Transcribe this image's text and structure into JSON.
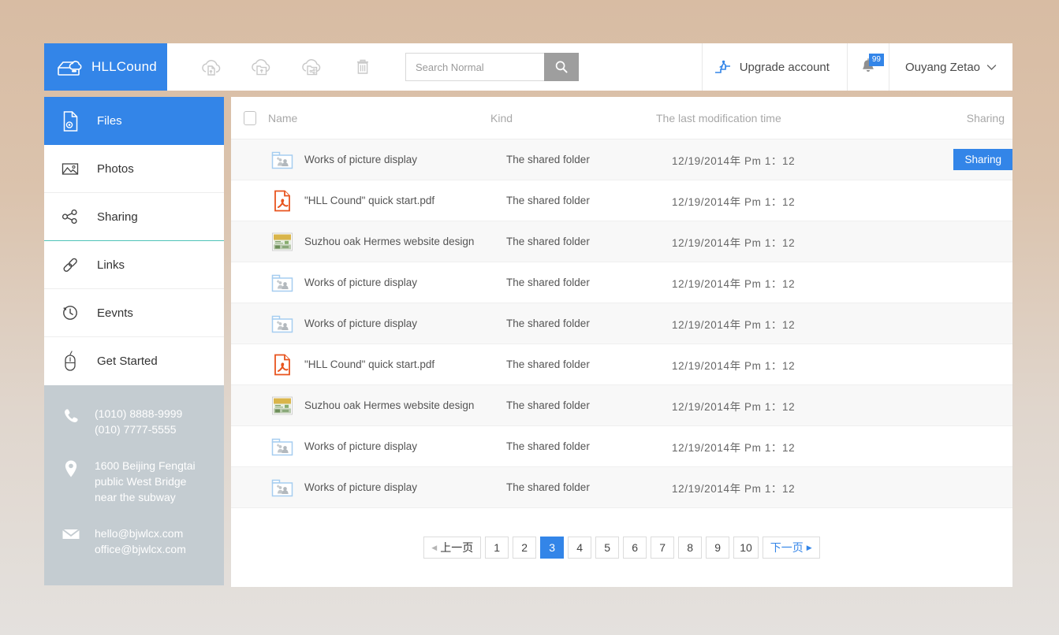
{
  "brand": {
    "name": "HLLCound",
    "logo_icon": "cloud-drive-logo-icon"
  },
  "toolbar": {
    "buttons": [
      {
        "name": "upload-file-icon",
        "label": "Upload file"
      },
      {
        "name": "upload-folder-icon",
        "label": "Upload folder"
      },
      {
        "name": "share-folder-icon",
        "label": "Share folder"
      },
      {
        "name": "trash-icon",
        "label": "Trash"
      }
    ]
  },
  "search": {
    "placeholder": "Search Normal",
    "value": "",
    "icon": "search-icon"
  },
  "account": {
    "upgrade_label": "Upgrade account",
    "upgrade_icon": "person-climbing-steps-icon",
    "notification_icon": "bell-icon",
    "notification_count": "99",
    "user_name": "Ouyang Zetao",
    "chevron_icon": "chevron-down-icon"
  },
  "sidebar": {
    "items": [
      {
        "label": "Files",
        "icon": "file-document-icon",
        "active": true
      },
      {
        "label": "Photos",
        "icon": "photo-image-icon",
        "active": false
      },
      {
        "label": "Sharing",
        "icon": "share-nodes-icon",
        "active": false
      },
      {
        "label": "Links",
        "icon": "link-chain-icon",
        "active": false
      },
      {
        "label": "Eevnts",
        "icon": "clock-history-icon",
        "active": false
      },
      {
        "label": "Get Started",
        "icon": "mouse-icon",
        "active": false
      }
    ],
    "contact": [
      {
        "icon": "phone-icon",
        "lines": [
          "(1010) 8888-9999",
          "(010) 7777-5555"
        ]
      },
      {
        "icon": "location-pin-icon",
        "lines": [
          "1600 Beijing Fengtai",
          "public West Bridge",
          "near the subway"
        ]
      },
      {
        "icon": "envelope-icon",
        "lines": [
          "hello@bjwlcx.com",
          "office@bjwlcx.com"
        ]
      }
    ]
  },
  "table": {
    "headers": {
      "name": "Name",
      "kind": "Kind",
      "time": "The last modification time",
      "sharing": "Sharing"
    },
    "rows": [
      {
        "icon": "shared-folder-icon",
        "name": "Works of picture display",
        "kind": "The shared folder",
        "time": "12/19/2014年 Pm 1：12",
        "sharing": "Sharing"
      },
      {
        "icon": "pdf-file-icon",
        "name": "\"HLL Cound\" quick start.pdf",
        "kind": "The shared folder",
        "time": "12/19/2014年 Pm 1：12",
        "sharing": ""
      },
      {
        "icon": "image-thumbnail-icon",
        "name": "Suzhou oak Hermes website design",
        "kind": "The shared folder",
        "time": "12/19/2014年 Pm 1：12",
        "sharing": ""
      },
      {
        "icon": "shared-folder-icon",
        "name": "Works of picture display",
        "kind": "The shared folder",
        "time": "12/19/2014年 Pm 1：12",
        "sharing": ""
      },
      {
        "icon": "shared-folder-icon",
        "name": "Works of picture display",
        "kind": "The shared folder",
        "time": "12/19/2014年 Pm 1：12",
        "sharing": ""
      },
      {
        "icon": "pdf-file-icon",
        "name": "\"HLL Cound\" quick start.pdf",
        "kind": "The shared folder",
        "time": "12/19/2014年 Pm 1：12",
        "sharing": ""
      },
      {
        "icon": "image-thumbnail-icon",
        "name": "Suzhou oak Hermes website design",
        "kind": "The shared folder",
        "time": "12/19/2014年 Pm 1：12",
        "sharing": ""
      },
      {
        "icon": "shared-folder-icon",
        "name": "Works of picture display",
        "kind": "The shared folder",
        "time": "12/19/2014年 Pm 1：12",
        "sharing": ""
      },
      {
        "icon": "shared-folder-icon",
        "name": "Works of picture display",
        "kind": "The shared folder",
        "time": "12/19/2014年 Pm 1：12",
        "sharing": ""
      }
    ]
  },
  "pagination": {
    "prev_label": "上一页",
    "next_label": "下一页",
    "pages": [
      "1",
      "2",
      "3",
      "4",
      "5",
      "6",
      "7",
      "8",
      "9",
      "10"
    ],
    "active_page": "3"
  },
  "colors": {
    "accent": "#3385e8",
    "teal_divider": "#4ec3b8",
    "pdf_orange": "#e8541e",
    "contact_bg": "#c4ccd1",
    "row_stripe": "#f8f8f8"
  }
}
